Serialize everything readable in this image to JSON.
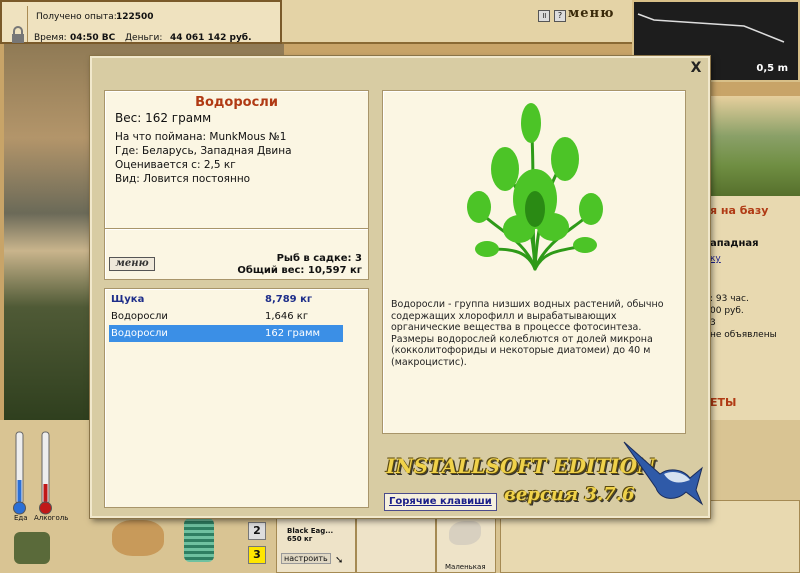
{
  "status": {
    "experience_label": "Получено опыта:",
    "experience_value": "122500",
    "time_label": "Время:",
    "time_value": "04:50 ВС",
    "money_label": "Деньги:",
    "money_value": "44 061 142 руб."
  },
  "topbar": {
    "pause_icon": "pause-icon",
    "help_label": "?",
    "menu_label": "меню"
  },
  "map": {
    "distance": "0,5 m"
  },
  "right_panel": {
    "heading_base": "я на базу",
    "location": "ападная",
    "link": "ку",
    "hours": ": 93 час.",
    "money": "00 руб.",
    "num": "3",
    "announced": "не объявлены",
    "section": "ЕТЫ"
  },
  "thermo": {
    "food_label": "Еда",
    "alcohol_label": "Алкоголь"
  },
  "bottom": {
    "slot2": "2",
    "slot3": "3",
    "bait_name": "Black Eag...",
    "bait_weight": "650 кг",
    "adjust_label": "настроить",
    "item_label": "Маленькая"
  },
  "dialog": {
    "fish_title": "Водоросли",
    "weight": "Вес: 162 грамм",
    "caught_on": "На что поймана: MunkMous №1",
    "where": "Где: Беларусь, Западная Двина",
    "value_from": "Оценивается с: 2,5 кг",
    "kind": "Вид: Ловится постоянно",
    "menu_logo": "меню",
    "fish_in_keep": "Рыб в садке: 3",
    "total_weight": "Общий вес: 10,597 кг",
    "catch_list": [
      {
        "name": "Щука",
        "weight": "8,789 кг"
      },
      {
        "name": "Водоросли",
        "weight": "1,646 кг"
      },
      {
        "name": "Водоросли",
        "weight": "162 грамм"
      }
    ],
    "description": "Водоросли - группа низших водных растений, обычно содержащих хлорофилл и вырабатывающих органические вещества в процессе фотосинтеза. Размеры водорослей колеблются от долей микрона (кокколитофориды и некоторые диатомеи) до 40 м (макроцистис).",
    "brand": "INSTALLSOFT EDITION",
    "version": "версия 3.7.6",
    "hotkeys_label": "Горячие клавиши",
    "close_label": "X"
  },
  "colors": {
    "accent": "#b03a14",
    "selection": "#3b8fe6",
    "link": "#1b1f8a"
  }
}
